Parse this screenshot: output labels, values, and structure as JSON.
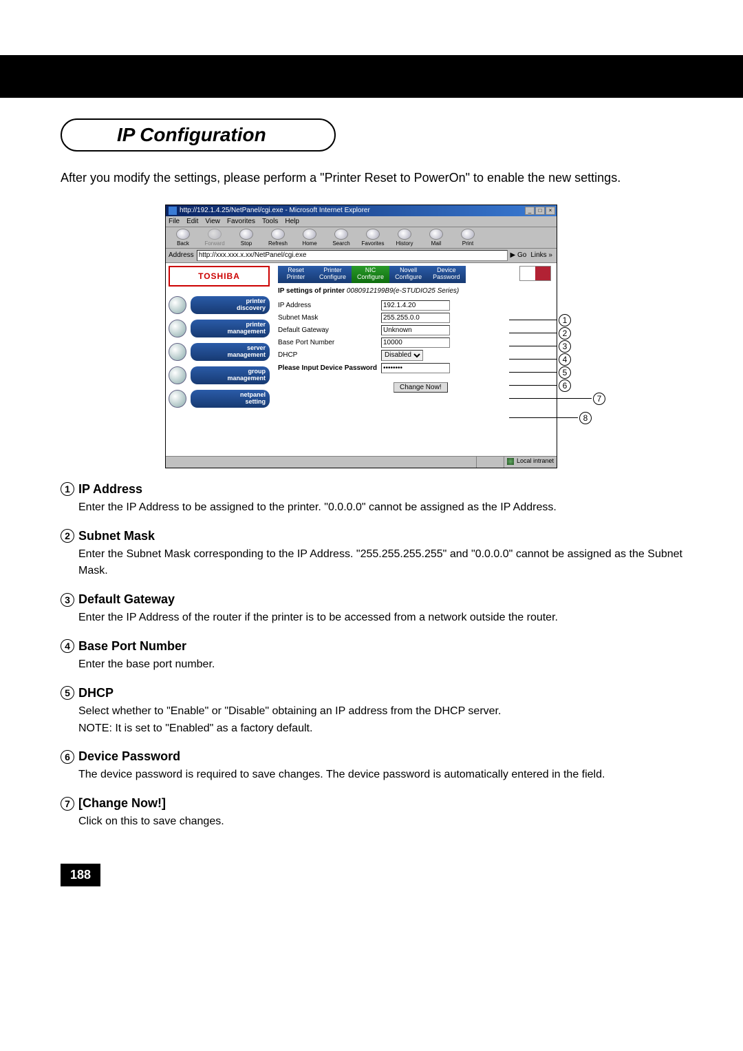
{
  "page": {
    "number": "188",
    "section_title": "IP Configuration",
    "intro": "After you modify the settings, please perform a \"Printer Reset to PowerOn\" to enable the new settings."
  },
  "browser": {
    "title": "http://192.1.4.25/NetPanel/cgi.exe - Microsoft Internet Explorer",
    "menu": [
      "File",
      "Edit",
      "View",
      "Favorites",
      "Tools",
      "Help"
    ],
    "toolbar": [
      {
        "label": "Back",
        "disabled": false
      },
      {
        "label": "Forward",
        "disabled": true
      },
      {
        "label": "Stop",
        "disabled": false
      },
      {
        "label": "Refresh",
        "disabled": false
      },
      {
        "label": "Home",
        "disabled": false
      },
      {
        "label": "Search",
        "disabled": false
      },
      {
        "label": "Favorites",
        "disabled": false
      },
      {
        "label": "History",
        "disabled": false
      },
      {
        "label": "Mail",
        "disabled": false
      },
      {
        "label": "Print",
        "disabled": false
      }
    ],
    "address_label": "Address",
    "address_value": "http://xxx.xxx.x.xx/NetPanel/cgi.exe",
    "go": "Go",
    "links": "Links »",
    "status": "Local intranet"
  },
  "netpanel": {
    "logo": "TOSHIBA",
    "sidebar": [
      {
        "line1": "printer",
        "line2": "discovery"
      },
      {
        "line1": "printer",
        "line2": "management"
      },
      {
        "line1": "server",
        "line2": "management"
      },
      {
        "line1": "group",
        "line2": "management"
      },
      {
        "line1": "netpanel",
        "line2": "setting"
      }
    ],
    "tabs": [
      {
        "line1": "Reset",
        "line2": "Printer",
        "kind": "std"
      },
      {
        "line1": "Printer",
        "line2": "Configure",
        "kind": "std"
      },
      {
        "line1": "NIC",
        "line2": "Configure",
        "kind": "nic"
      },
      {
        "line1": "Novell",
        "line2": "Configure",
        "kind": "std"
      },
      {
        "line1": "Device",
        "line2": "Password",
        "kind": "std"
      }
    ],
    "heading_prefix": "IP settings of printer",
    "printer_id": "0080912199B9(e-STUDIO25 Series)",
    "fields": {
      "ip_address": {
        "label": "IP Address",
        "value": "192.1.4.20"
      },
      "subnet_mask": {
        "label": "Subnet Mask",
        "value": "255.255.0.0"
      },
      "default_gateway": {
        "label": "Default Gateway",
        "value": "Unknown"
      },
      "base_port": {
        "label": "Base Port Number",
        "value": "10000"
      },
      "dhcp": {
        "label": "DHCP",
        "value": "Disabled"
      },
      "password": {
        "label": "Please Input Device Password",
        "value": "********"
      }
    },
    "change_button": "Change Now!"
  },
  "callouts": [
    "1",
    "2",
    "3",
    "4",
    "5",
    "6",
    "7",
    "8"
  ],
  "definitions": [
    {
      "num": "1",
      "title": "IP Address",
      "body": "Enter the IP Address to be assigned to the printer. \"0.0.0.0\" cannot be assigned as the IP Address."
    },
    {
      "num": "2",
      "title": "Subnet Mask",
      "body": "Enter the Subnet Mask corresponding to the IP Address.  \"255.255.255.255\" and \"0.0.0.0\" cannot be assigned as the Subnet Mask."
    },
    {
      "num": "3",
      "title": "Default Gateway",
      "body": "Enter the IP Address of the router if the printer is to be accessed from a network outside the router."
    },
    {
      "num": "4",
      "title": "Base Port Number",
      "body": "Enter the base port number."
    },
    {
      "num": "5",
      "title": "DHCP",
      "body": "Select whether to \"Enable\" or \"Disable\" obtaining an IP address from the DHCP server.\nNOTE: It is set to \"Enabled\" as a factory default."
    },
    {
      "num": "6",
      "title": "Device Password",
      "body": "The device password is required to save changes.  The device password is automatically entered in the field."
    },
    {
      "num": "7",
      "title": "[Change Now!]",
      "body": "Click on this to save changes."
    }
  ]
}
